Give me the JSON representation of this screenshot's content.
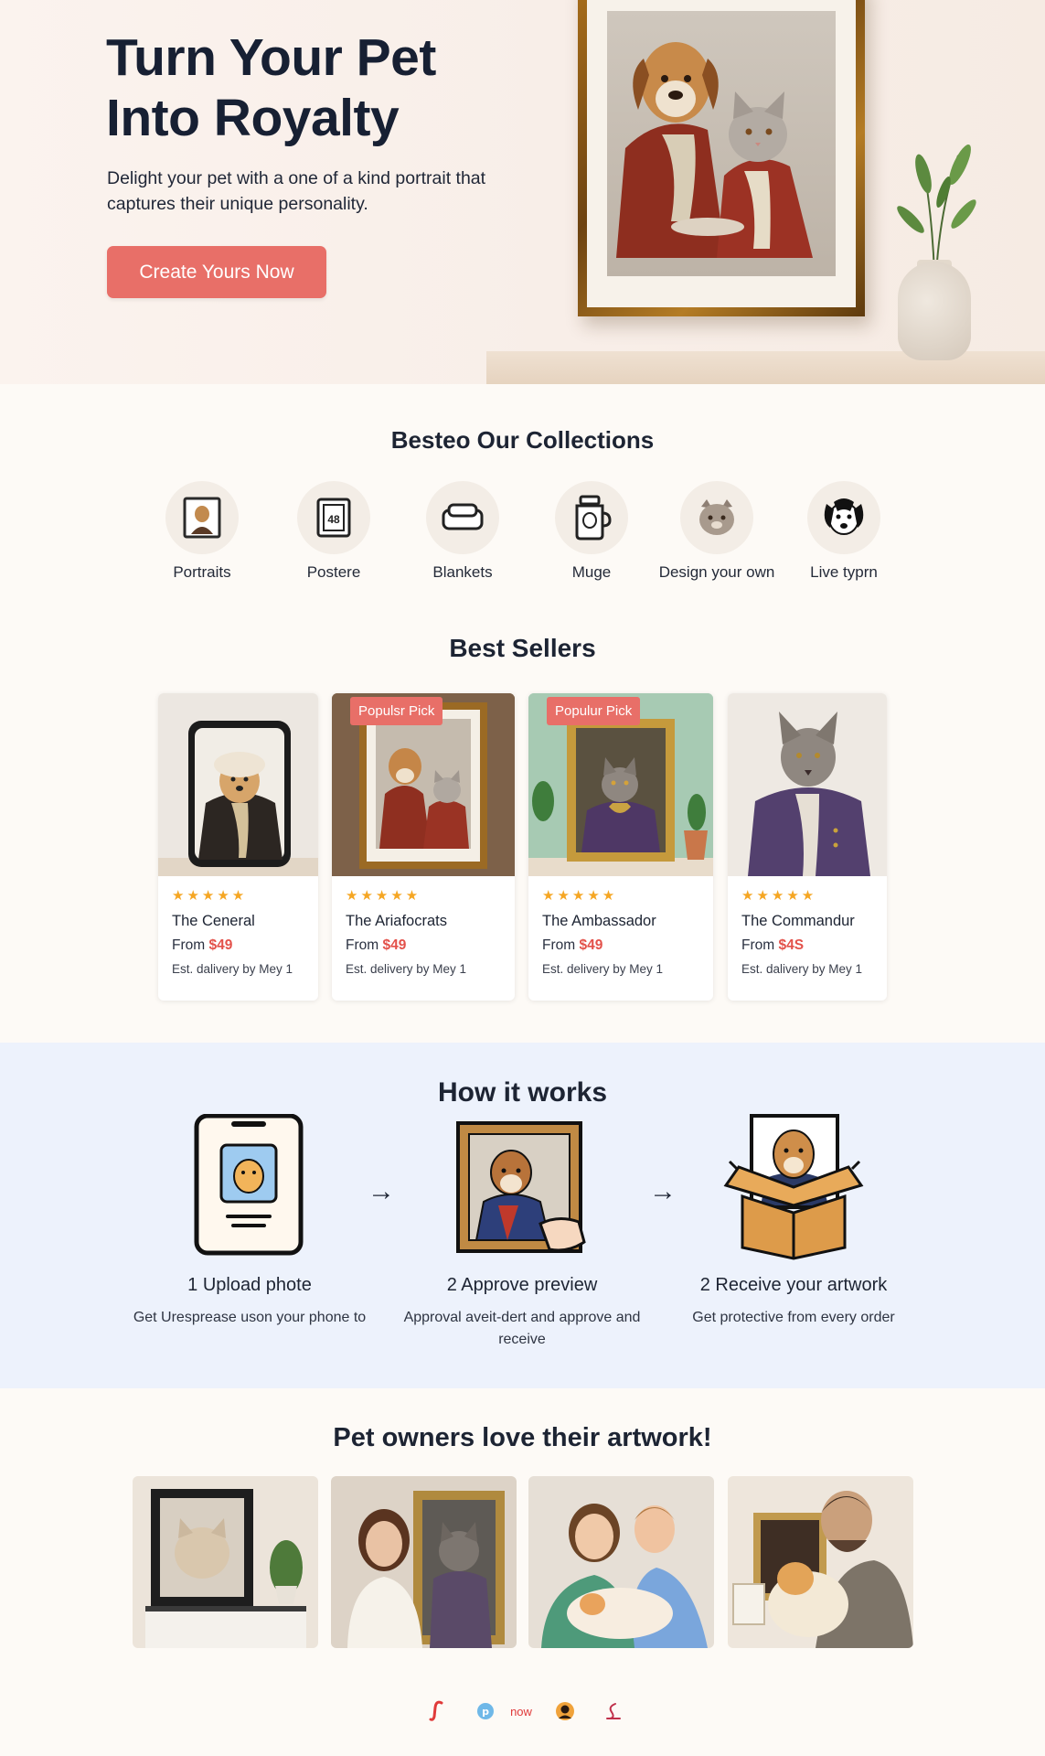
{
  "hero": {
    "title": "Turn Your Pet Into Royalty",
    "subtitle": "Delight your pet with a one of a kind portrait that captures their unique personality.",
    "cta_label": "Create Yours Now"
  },
  "collections": {
    "title": "Besteo Our Collections",
    "items": [
      {
        "label": "Portraits",
        "icon": "portrait-icon"
      },
      {
        "label": "Postere",
        "icon": "poster-icon"
      },
      {
        "label": "Blankets",
        "icon": "blanket-icon"
      },
      {
        "label": "Muge",
        "icon": "mug-icon"
      },
      {
        "label": "Design your own",
        "icon": "cat-icon"
      },
      {
        "label": "Live typrn",
        "icon": "dog-face-icon"
      }
    ]
  },
  "best_sellers": {
    "title": "Best Sellers",
    "products": [
      {
        "name": "The Ceneral",
        "from": "From",
        "price": "$49",
        "delivery": "Est. dalivery by Mey 1",
        "badge": "",
        "stars": "★★★★★"
      },
      {
        "name": "The Ariafocrats",
        "from": "From",
        "price": "$49",
        "delivery": "Est. delivery by Mey 1",
        "badge": "Populsr Pick",
        "stars": "★★★★★"
      },
      {
        "name": "The Ambassador",
        "from": "From",
        "price": "$49",
        "delivery": "Est. delivery by Mey 1",
        "badge": "Populur Pick",
        "stars": "★★★★★"
      },
      {
        "name": "The Commandur",
        "from": "From",
        "price": "$4S",
        "delivery": "Est. dalivery by Mey 1",
        "badge": "",
        "stars": "★★★★★"
      }
    ]
  },
  "how_it_works": {
    "title": "How it works",
    "steps": [
      {
        "title": "1 Upload phote",
        "desc": "Get Uresprease uson your phone to"
      },
      {
        "title": "2 Approve preview",
        "desc": "Approval aveit-dert and approve and receive"
      },
      {
        "title": "2 Receive your artwork",
        "desc": "Get protective from every order"
      }
    ],
    "arrow_glyph": "→"
  },
  "testimonials": {
    "title": "Pet owners love their artwork!"
  },
  "footer": {
    "now_label": "now"
  },
  "colors": {
    "accent": "#e86f68",
    "price": "#e3514a",
    "star": "#f5a623",
    "how_bg": "#edf2fc"
  }
}
